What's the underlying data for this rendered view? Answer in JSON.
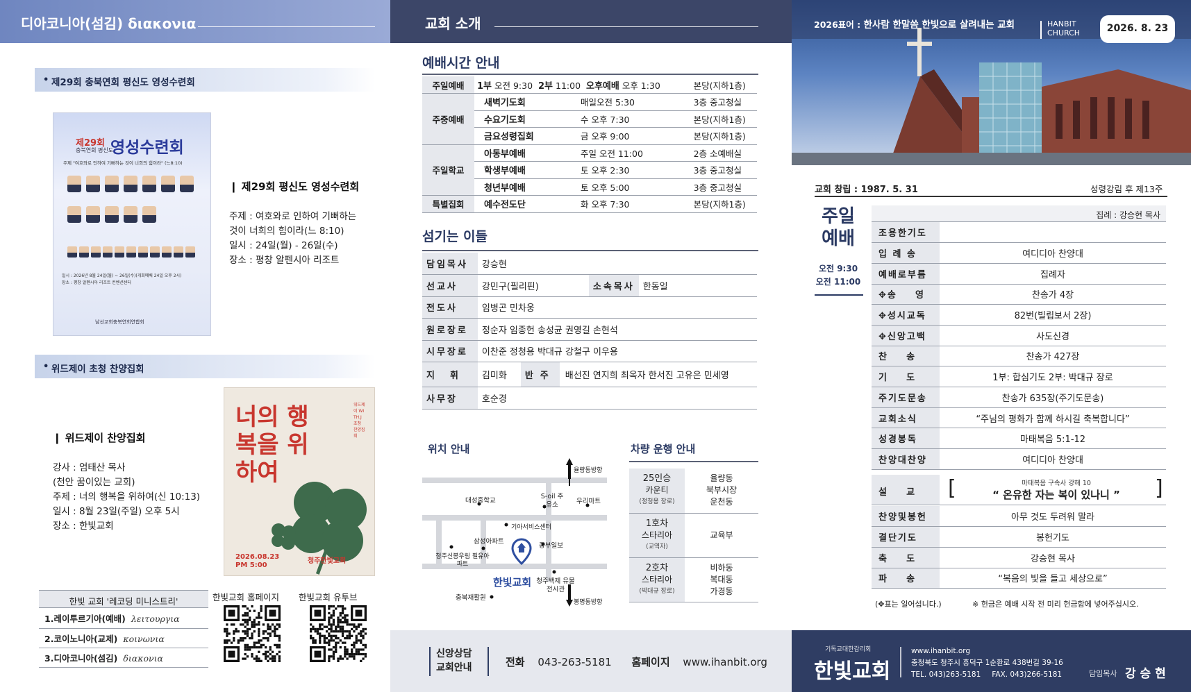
{
  "panel1": {
    "header": "디아코니아(섬김) διακονια",
    "section1": {
      "bar": "제29회 충북연회 평신도 영성수련회",
      "poster": {
        "top": "제29회",
        "sub": "충북연회 평신도",
        "title": "영성수련회",
        "theme": "주제 \"여호와로 인하여 기뻐하는 것이 너희의 힘이라\" (느8:10)",
        "date_line": "일시 : 2026년 8월 24일(월) ~ 26일(수)(개회예배 24일 오후 2시)",
        "place_line": "장소 : 평창 알펜시아 리조트 컨벤션센터",
        "org": "남선교회충북연회연합회"
      },
      "title": "제29회 평신도 영성수련회",
      "lines": [
        "주제 :  여호와로 인하여  기뻐하는",
        "          것이 너희의 힘이라(느 8:10)",
        "일시 :  24일(월)  -  26일(수)",
        "장소 :  평창  알펜시아  리조트"
      ]
    },
    "section2": {
      "bar": "위드제이 초청 찬양집회",
      "poster": {
        "title": "너의 행복을 위하여",
        "side": "위드제이 WITH.J 초청 찬양집회",
        "date": "2026.08.23",
        "time": "PM 5:00",
        "church": "청주한빛교회"
      },
      "title": "위드제이 찬양집회",
      "lines": [
        "강사 :  엄태산  목사",
        "          (천안  꿈이있는  교회)",
        "주제 :  너의  행복을  위하여(신 10:13)",
        "일시 :  8월  23일(주일)  오후  5시",
        "장소 :  한빛교회"
      ]
    },
    "ministry": {
      "header": "한빛 교회 '레코딩 미니스트리'",
      "items": [
        {
          "label": "1.레이투르기아(예배)",
          "greek": "λειτουργια"
        },
        {
          "label": "2.코이노니아(교제)",
          "greek": "κοινωνια"
        },
        {
          "label": "3.디아코니아(섬김)",
          "greek": "διακονια"
        }
      ]
    },
    "qr_home_label": "한빛교회 홈페이지",
    "qr_youtube_label": "한빛교회 유투브"
  },
  "panel2": {
    "header": "교회 소개",
    "worship_title": "예배시간 안내",
    "worship": {
      "sunday_cat": "주일예배",
      "sunday_line": {
        "a": "1부",
        "at": "오전 9:30",
        "b": "2부",
        "bt": "11:00",
        "c": "오후예배",
        "ct": "오후 1:30",
        "place": "본당(지하1층)"
      },
      "midweek_cat": "주중예배",
      "midweek": [
        {
          "name": "새벽기도회",
          "time": "매일오전 5:30",
          "place": "3층  중고청실"
        },
        {
          "name": "수요기도회",
          "time": "수  오후  7:30",
          "place": "본당(지하1층)"
        },
        {
          "name": "금요성령집회",
          "time": "금  오후  9:00",
          "place": "본당(지하1층)"
        }
      ],
      "school_cat": "주일학교",
      "school": [
        {
          "name": "아동부예배",
          "time": "주일  오전  11:00",
          "place": "2층  소예배실"
        },
        {
          "name": "학생부예배",
          "time": "토  오후  2:30",
          "place": "3층  중고청실"
        },
        {
          "name": "청년부예배",
          "time": "토  오후  5:00",
          "place": "3층  중고청실"
        }
      ],
      "special_cat": "특별집회",
      "special": {
        "name": "예수전도단",
        "time": "화  오후  7:30",
        "place": "본당(지하1층)"
      }
    },
    "staff_title": "섬기는 이들",
    "staff": {
      "pastor_k": "담임목사",
      "pastor_v": "강승현",
      "missionary_k": "선교사",
      "missionary_v": "강민구(필리핀)",
      "assoc_k": "소속목사",
      "assoc_v": "한동일",
      "evangelist_k": "전도사",
      "evangelist_v": "임병곤  민차웅",
      "elder_k": "원로장로",
      "elder_v": "정순자  임종헌  송성균  권영길  손현석",
      "active_k": "시무장로",
      "active_v": "이찬준  정청용  박대규  강철구  이우용",
      "conductor_k": "지휘",
      "conductor_v": "김미화",
      "accomp_k": "반주",
      "accomp_v": "배선진  연지희  최옥자  한서진  고유은  민세영",
      "office_k": "사무장",
      "office_v": "호순경"
    },
    "map_title": "위치 안내",
    "map": {
      "north": "율량동방향",
      "south": "봉명동방향",
      "labels": [
        "대성중학교",
        "S-oil 주유소",
        "우리마트",
        "기아서비스센터",
        "삼성아파트",
        "중부일보",
        "청주신봉우림 필유아파트",
        "청주백제 유물전시관",
        "충북재활원"
      ],
      "church": "한빛교회"
    },
    "bus_title": "차량 운행 안내",
    "bus": [
      {
        "car": "25인승",
        "car2": "카운티",
        "note": "(정청용 장로)",
        "route": [
          "율량동",
          "북부시장",
          "운천동"
        ]
      },
      {
        "car": "1호차",
        "car2": "스타리아",
        "note": "(교역자)",
        "route": [
          "교육부"
        ]
      },
      {
        "car": "2호차",
        "car2": "스타리아",
        "note": "(박대규 장로)",
        "route": [
          "비하동",
          "복대동",
          "가경동"
        ]
      }
    ],
    "footer": {
      "label1": "신앙상담",
      "label2": "교회안내",
      "tel_label": "전화",
      "tel": "043-263-5181",
      "home_label": "홈페이지",
      "home": "www.ihanbit.org"
    }
  },
  "panel3": {
    "motto_prefix": "2026표어 :",
    "motto": "한사람 한말씀 한빛으로 살려내는 교회",
    "brand1": "HANBIT",
    "brand2": "CHURCH",
    "date": "2026. 8. 23",
    "founded": "교회 창립 : 1987. 5. 31",
    "week": "성령강림 후 제13주",
    "service_title1": "주일",
    "service_title2": "예배",
    "time1": "오전 9:30",
    "time2": "오전 11:00",
    "officiant": "집례 : 강승현 목사",
    "order": [
      {
        "k": "조용한기도",
        "v": ""
      },
      {
        "k": "입 례 송",
        "v": "여디디아 찬양대"
      },
      {
        "k": "예배로부름",
        "v": "집례자"
      },
      {
        "k": "✥송    영",
        "v": "찬송가 4장"
      },
      {
        "k": "✥성시교독",
        "v": "82번(빌립보서 2장)"
      },
      {
        "k": "✥신앙고백",
        "v": "사도신경"
      },
      {
        "k": "찬    송",
        "v": "찬송가 427장"
      },
      {
        "k": "기    도",
        "v": "1부: 합심기도  2부: 박대규 장로"
      },
      {
        "k": "주기도문송",
        "v": "찬송가 635장(주기도문송)"
      },
      {
        "k": "교회소식",
        "v": "“주님의 평화가 함께 하시길 축복합니다”"
      },
      {
        "k": "성경봉독",
        "v": "마태복음  5:1-12"
      },
      {
        "k": "찬양대찬양",
        "v": "여디디아  찬양대"
      }
    ],
    "sermon_k": "설    교",
    "sermon_series": "마태복음 구속사 강해 10",
    "sermon_title": "“ 온유한 자는 복이 있나니 ”",
    "order2": [
      {
        "k": "찬양및봉헌",
        "v": "아무  것도  두려워  말라"
      },
      {
        "k": "결단기도",
        "v": "봉헌기도"
      },
      {
        "k": "축    도",
        "v": "강승현  목사"
      },
      {
        "k": "파    송",
        "v": "“복음의  빛을  들고  세상으로”"
      }
    ],
    "note_left": "(✥표는 일어섭니다.)",
    "note_right": "※ 헌금은 예배 시작 전 미리 헌금함에 넣어주십시오.",
    "footer": {
      "denom": "기독교대한감리회",
      "name": "한빛교회",
      "web": "www.ihanbit.org",
      "addr": "충청북도 청주시 흥덕구 1순환로 438번길 39-16",
      "tel": "TEL. 043)263-5181",
      "fax": "FAX. 043)266-5181",
      "pastor_label": "담임목사",
      "pastor": "강 승 현"
    }
  },
  "colors": {
    "header1": "#7f94c6",
    "header2": "#3c4668",
    "navy": "#2f3d63",
    "poster_red": "#c8362e",
    "clover": "#3e6b4c"
  }
}
